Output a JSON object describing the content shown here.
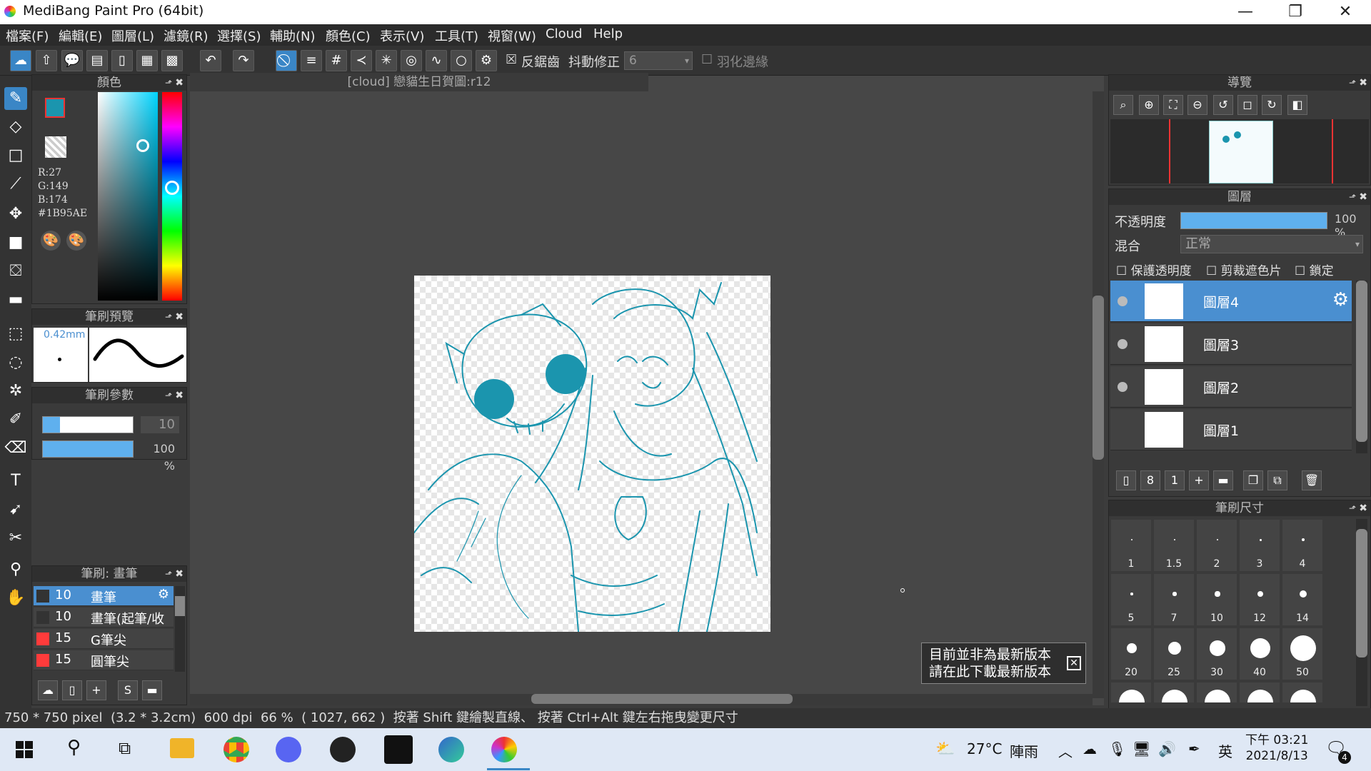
{
  "window": {
    "title": "MediBang Paint Pro (64bit)",
    "minimize": "—",
    "restore": "❐",
    "close": "✕"
  },
  "menu": [
    "檔案(F)",
    "編輯(E)",
    "圖層(L)",
    "濾鏡(R)",
    "選擇(S)",
    "輔助(N)",
    "顏色(C)",
    "表示(V)",
    "工具(T)",
    "視窗(W)",
    "Cloud",
    "Help"
  ],
  "toolbar": {
    "antialias": "反鋸齒",
    "stabilizer_label": "抖動修正",
    "stabilizer_value": "6",
    "feather": "羽化邊緣"
  },
  "color_panel": {
    "title": "顏色",
    "r": "R:27",
    "g": "G:149",
    "b": "B:174",
    "hex": "#1B95AE",
    "fg_color": "#1B95AE"
  },
  "brush_preview": {
    "title": "筆刷預覽",
    "size": "0.42mm"
  },
  "brush_params": {
    "title": "筆刷參數",
    "size": "10",
    "opacity": "100 %"
  },
  "brush_list": {
    "title": "筆刷: 畫筆",
    "items": [
      {
        "size": "10",
        "name": "畫筆",
        "color": "#333333"
      },
      {
        "size": "10",
        "name": "畫筆(起筆/收",
        "color": "#333333"
      },
      {
        "size": "15",
        "name": "G筆尖",
        "color": "#ff3b3b"
      },
      {
        "size": "15",
        "name": "圓筆尖",
        "color": "#ff3b3b"
      }
    ]
  },
  "document": {
    "tab": "[cloud] 戀貓生日賀圖:r12"
  },
  "notice": {
    "line1": "目前並非為最新版本",
    "line2": "請在此下載最新版本"
  },
  "navigator": {
    "title": "導覽"
  },
  "layers": {
    "title": "圖層",
    "opacity_label": "不透明度",
    "opacity_value": "100 %",
    "blend_label": "混合",
    "blend_value": "正常",
    "protect_alpha": "保護透明度",
    "clipping": "剪裁遮色片",
    "lock": "鎖定",
    "items": [
      "圖層4",
      "圖層3",
      "圖層2",
      "圖層1"
    ]
  },
  "brush_size": {
    "title": "筆刷尺寸",
    "sizes": [
      "1",
      "1.5",
      "2",
      "3",
      "4",
      "5",
      "7",
      "10",
      "12",
      "14",
      "20",
      "25",
      "30",
      "40",
      "50"
    ]
  },
  "status": {
    "dims": "750 * 750 pixel",
    "cm": "(3.2 * 3.2cm)",
    "dpi": "600 dpi",
    "zoom": "66 %",
    "coords": "( 1027, 662 )",
    "hint": "按著 Shift 鍵繪製直線、 按著 Ctrl+Alt 鍵左右拖曳變更尺寸"
  },
  "taskbar": {
    "weather": "27°C",
    "weather_text": "陣雨",
    "ime": "英",
    "time": "下午 03:21",
    "date": "2021/8/13",
    "notifications": "4"
  }
}
